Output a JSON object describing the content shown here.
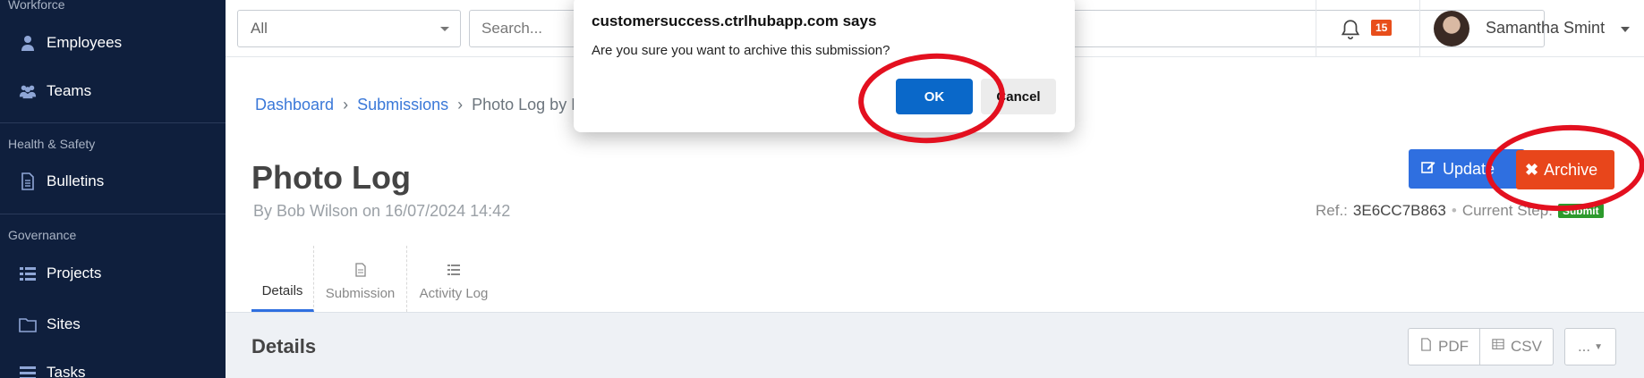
{
  "sidebar": {
    "sections": {
      "workforce": "Workforce",
      "health_safety": "Health & Safety",
      "governance": "Governance"
    },
    "items": {
      "employees": "Employees",
      "teams": "Teams",
      "bulletins": "Bulletins",
      "projects": "Projects",
      "sites": "Sites",
      "tasks": "Tasks"
    }
  },
  "topbar": {
    "filter_value": "All",
    "search_placeholder": "Search...",
    "notification_count": "15",
    "user_name": "Samantha Smint"
  },
  "breadcrumb": {
    "dashboard": "Dashboard",
    "submissions": "Submissions",
    "current": "Photo Log by B"
  },
  "page": {
    "title": "Photo Log",
    "subtitle": "By Bob Wilson on 16/07/2024 14:42",
    "update_label": "Update",
    "archive_label": "Archive",
    "ref_label": "Ref.:",
    "ref_value": "3E6CC7B863",
    "step_label": "Current Step:",
    "step_value": "Submit"
  },
  "tabs": {
    "details": "Details",
    "submission": "Submission",
    "activity_log": "Activity Log"
  },
  "details": {
    "title": "Details",
    "pdf_label": "PDF",
    "csv_label": "CSV",
    "more_label": "..."
  },
  "dialog": {
    "title": "customersuccess.ctrlhubapp.com says",
    "message": "Are you sure you want to archive this submission?",
    "ok_label": "OK",
    "cancel_label": "Cancel"
  },
  "colors": {
    "sidebar_bg": "#0f1f3d",
    "primary": "#2f6fe0",
    "danger": "#e8461b",
    "ok_button": "#0a68c9",
    "annotation_red": "#e3101f"
  }
}
